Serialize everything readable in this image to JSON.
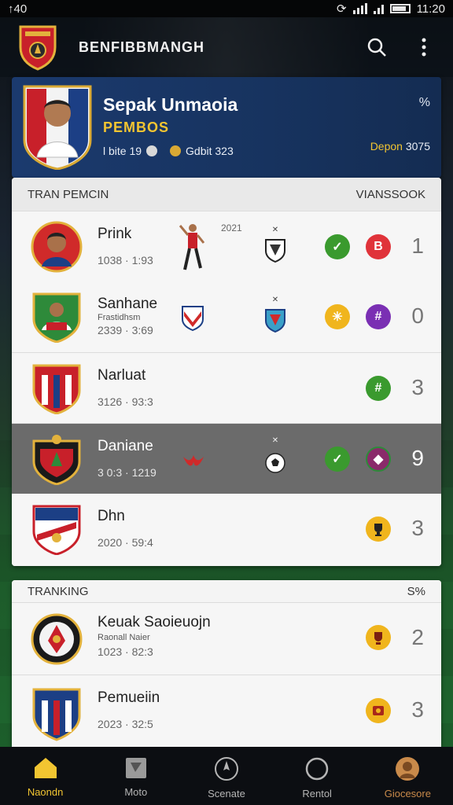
{
  "status": {
    "time_left": "↑40",
    "time_right": "11:20"
  },
  "app": {
    "title": "BENFIBBMANGH"
  },
  "featured": {
    "name": "Sepak Unmaoia",
    "subtitle": "PEMBOS",
    "stat1": "l bite 19",
    "stat2": "Gdbit 323",
    "close": "%",
    "points_label": "Depon",
    "points_value": "3075"
  },
  "card1": {
    "left_header": "TRAN PEMCIN",
    "right_header": "VIANSSOOK",
    "rows": [
      {
        "name": "Prink",
        "date": "1038 · 1:93",
        "label": "2021",
        "score": "1",
        "c1_glyph": "✓",
        "c2_glyph": "B"
      },
      {
        "name": "Sanhane",
        "subname": "Frastidhsm",
        "date": "2339 · 3:69",
        "score": "0",
        "c1_glyph": "✳",
        "c2_glyph": "#"
      },
      {
        "name": "Narluat",
        "date": "3126 · 93:3",
        "score": "3",
        "c1_glyph": "#"
      },
      {
        "name": "Daniane",
        "date": "3 0:3 · 1219",
        "score": "9",
        "c1_glyph": "✓",
        "c2_glyph": "◆"
      },
      {
        "name": "Dhn",
        "date": "2020 · 59:4",
        "score": "3"
      }
    ]
  },
  "card2": {
    "left_header": "TRANKING",
    "right_header": "S%",
    "rows": [
      {
        "name": "Keuak Saoieuojn",
        "subname": "Raonall Naier",
        "date": "1023 · 82:3",
        "score": "2"
      },
      {
        "name": "Pemueiin",
        "date": "2023 · 32:5",
        "score": "3"
      }
    ]
  },
  "nav": [
    {
      "label": "Naondn",
      "icon": "home-icon"
    },
    {
      "label": "Moto",
      "icon": "card-icon"
    },
    {
      "label": "Scenate",
      "icon": "compass-icon"
    },
    {
      "label": "Rentol",
      "icon": "circle-icon"
    },
    {
      "label": "Giocesore",
      "icon": "profile-icon"
    }
  ],
  "colors": {
    "accent": "#f2c531",
    "header_blue": "#1b3a6e",
    "green": "#3a9a2e",
    "red": "#e0333a",
    "purple": "#7a2fb3",
    "yellow": "#f0b51d"
  }
}
